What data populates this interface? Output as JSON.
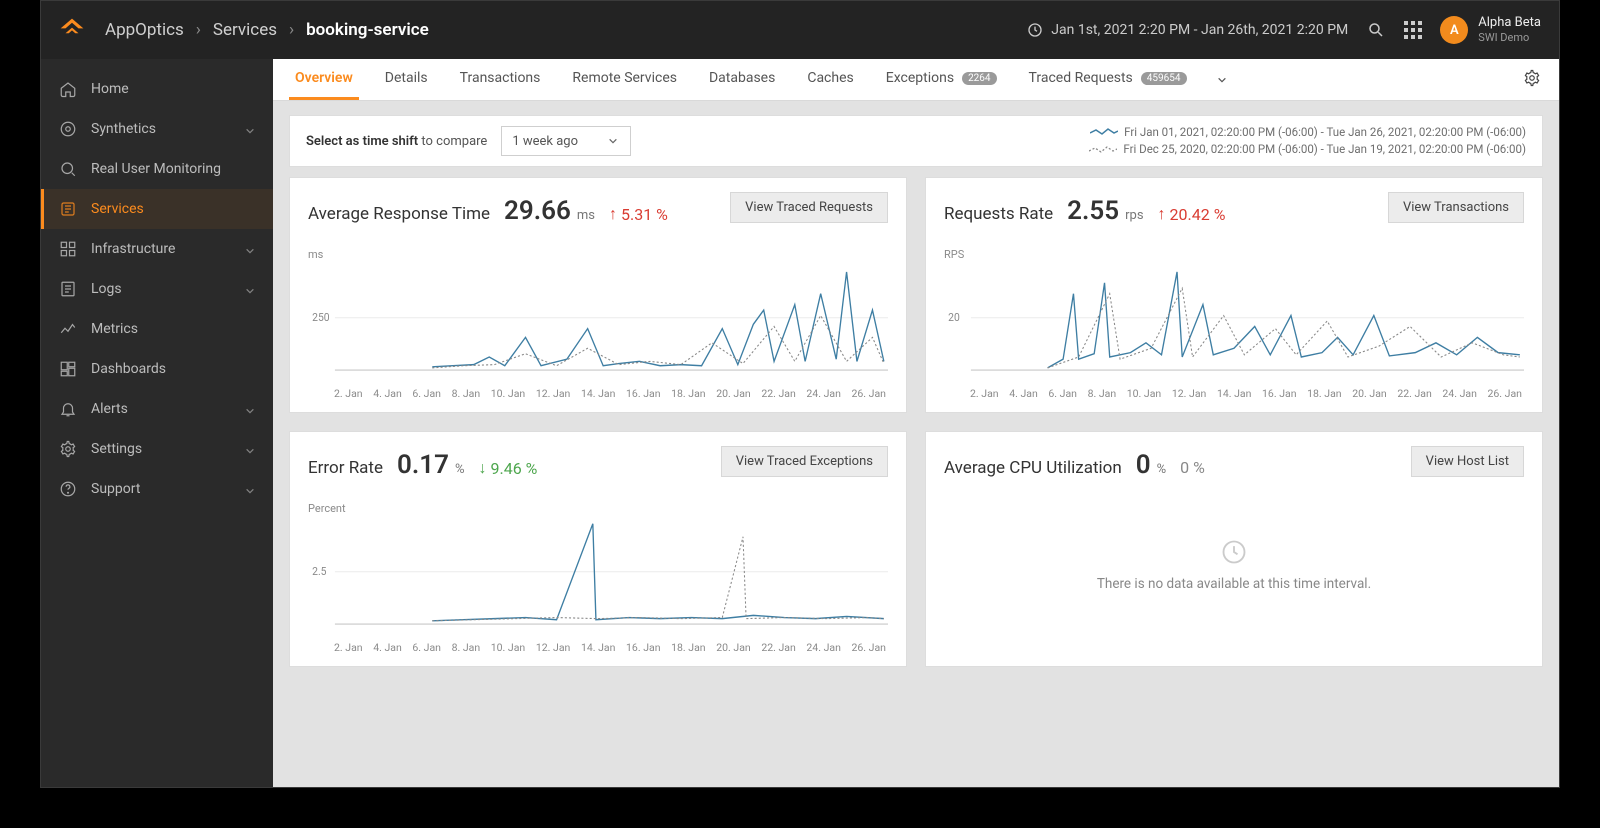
{
  "header": {
    "breadcrumb": [
      "AppOptics",
      "Services",
      "booking-service"
    ],
    "time_range": "Jan 1st, 2021 2:20 PM - Jan 26th, 2021 2:20 PM",
    "user": {
      "initial": "A",
      "name": "Alpha Beta",
      "tenant": "SWI Demo"
    }
  },
  "sidebar": {
    "items": [
      {
        "label": "Home"
      },
      {
        "label": "Synthetics",
        "expandable": true
      },
      {
        "label": "Real User Monitoring"
      },
      {
        "label": "Services",
        "active": true
      },
      {
        "label": "Infrastructure",
        "expandable": true
      },
      {
        "label": "Logs",
        "expandable": true
      },
      {
        "label": "Metrics"
      },
      {
        "label": "Dashboards"
      },
      {
        "label": "Alerts",
        "expandable": true
      },
      {
        "label": "Settings",
        "expandable": true
      },
      {
        "label": "Support",
        "expandable": true
      }
    ]
  },
  "tabs": [
    {
      "label": "Overview",
      "active": true
    },
    {
      "label": "Details"
    },
    {
      "label": "Transactions"
    },
    {
      "label": "Remote Services"
    },
    {
      "label": "Databases"
    },
    {
      "label": "Caches"
    },
    {
      "label": "Exceptions",
      "badge": "2264"
    },
    {
      "label": "Traced Requests",
      "badge": "459654"
    }
  ],
  "filter": {
    "prefix": "Select as time shift",
    "suffix": "to compare",
    "selected": "1 week ago",
    "legend_current": "Fri Jan 01, 2021, 02:20:00 PM (-06:00) - Tue Jan 26, 2021, 02:20:00 PM (-06:00)",
    "legend_previous": "Fri Dec 25, 2020, 02:20:00 PM (-06:00) - Tue Jan 19, 2021, 02:20:00 PM (-06:00)"
  },
  "cards": {
    "response": {
      "title": "Average Response Time",
      "value": "29.66",
      "unit": "ms",
      "delta": "5.31 %",
      "dir": "up",
      "button": "View Traced Requests",
      "yl": "ms",
      "ytick": "250"
    },
    "requests": {
      "title": "Requests Rate",
      "value": "2.55",
      "unit": "rps",
      "delta": "20.42 %",
      "dir": "up",
      "button": "View Transactions",
      "yl": "RPS",
      "ytick": "20"
    },
    "error": {
      "title": "Error Rate",
      "value": "0.17",
      "unit": "%",
      "delta": "9.46 %",
      "dir": "down",
      "button": "View Traced Exceptions",
      "yl": "Percent",
      "ytick": "2.5"
    },
    "cpu": {
      "title": "Average CPU Utilization",
      "value": "0",
      "unit": "%",
      "delta": "0 %",
      "dir": "neutral",
      "button": "View Host List",
      "empty": "There is no data available at this time interval."
    }
  },
  "xaxis": [
    "2. Jan",
    "4. Jan",
    "6. Jan",
    "8. Jan",
    "10. Jan",
    "12. Jan",
    "14. Jan",
    "16. Jan",
    "18. Jan",
    "20. Jan",
    "22. Jan",
    "24. Jan",
    "26. Jan"
  ],
  "chart_data": [
    {
      "type": "line",
      "title": "Average Response Time",
      "ylabel": "ms",
      "ylim": [
        0,
        500
      ],
      "x": [
        "2. Jan",
        "4. Jan",
        "6. Jan",
        "8. Jan",
        "10. Jan",
        "12. Jan",
        "14. Jan",
        "16. Jan",
        "18. Jan",
        "20. Jan",
        "22. Jan",
        "24. Jan",
        "26. Jan"
      ],
      "series": [
        {
          "name": "current",
          "values": [
            0,
            0,
            0,
            30,
            35,
            40,
            45,
            35,
            30,
            90,
            60,
            120,
            460
          ]
        },
        {
          "name": "1 week ago",
          "values": [
            0,
            0,
            0,
            25,
            30,
            35,
            35,
            30,
            25,
            70,
            50,
            90,
            200
          ]
        }
      ]
    },
    {
      "type": "line",
      "title": "Requests Rate",
      "ylabel": "RPS",
      "ylim": [
        0,
        40
      ],
      "x": [
        "2. Jan",
        "4. Jan",
        "6. Jan",
        "8. Jan",
        "10. Jan",
        "12. Jan",
        "14. Jan",
        "16. Jan",
        "18. Jan",
        "20. Jan",
        "22. Jan",
        "24. Jan",
        "26. Jan"
      ],
      "series": [
        {
          "name": "current",
          "values": [
            0,
            0,
            0,
            2,
            8,
            4,
            30,
            25,
            6,
            10,
            5,
            12,
            4
          ]
        },
        {
          "name": "1 week ago",
          "values": [
            0,
            0,
            2,
            6,
            4,
            24,
            22,
            6,
            8,
            5,
            10,
            4,
            3
          ]
        }
      ]
    },
    {
      "type": "line",
      "title": "Error Rate",
      "ylabel": "Percent",
      "ylim": [
        0,
        5
      ],
      "x": [
        "2. Jan",
        "4. Jan",
        "6. Jan",
        "8. Jan",
        "10. Jan",
        "12. Jan",
        "14. Jan",
        "16. Jan",
        "18. Jan",
        "20. Jan",
        "22. Jan",
        "24. Jan",
        "26. Jan"
      ],
      "series": [
        {
          "name": "current",
          "values": [
            0,
            0,
            0,
            0.2,
            0.2,
            0.3,
            4.8,
            0.2,
            0.2,
            0.3,
            0.3,
            0.3,
            0.2
          ]
        },
        {
          "name": "1 week ago",
          "values": [
            0,
            0,
            0.2,
            0.2,
            0.3,
            0.3,
            0.2,
            0.2,
            3.2,
            0.3,
            0.3,
            0.2,
            0.2
          ]
        }
      ]
    },
    {
      "type": "line",
      "title": "Average CPU Utilization",
      "ylabel": "%",
      "ylim": [
        0,
        100
      ],
      "x": [],
      "series": [],
      "empty": true
    }
  ]
}
